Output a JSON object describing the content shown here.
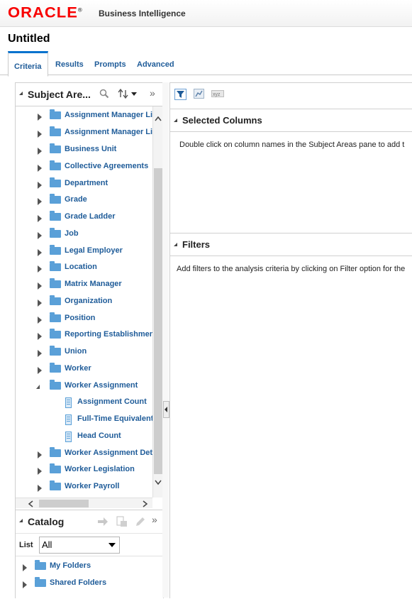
{
  "header": {
    "logo": "ORACLE",
    "trademark": "®",
    "product": "Business Intelligence"
  },
  "page": {
    "title": "Untitled"
  },
  "tabs": [
    {
      "label": "Criteria",
      "active": true
    },
    {
      "label": "Results",
      "active": false
    },
    {
      "label": "Prompts",
      "active": false
    },
    {
      "label": "Advanced",
      "active": false
    }
  ],
  "subject_areas": {
    "title": "Subject Are...",
    "items": [
      {
        "label": "Assignment Manager Lis",
        "type": "folder"
      },
      {
        "label": "Assignment Manager Lis",
        "type": "folder"
      },
      {
        "label": "Business Unit",
        "type": "folder"
      },
      {
        "label": "Collective Agreements",
        "type": "folder"
      },
      {
        "label": "Department",
        "type": "folder"
      },
      {
        "label": "Grade",
        "type": "folder"
      },
      {
        "label": "Grade Ladder",
        "type": "folder"
      },
      {
        "label": "Job",
        "type": "folder"
      },
      {
        "label": "Legal Employer",
        "type": "folder"
      },
      {
        "label": "Location",
        "type": "folder"
      },
      {
        "label": "Matrix Manager",
        "type": "folder"
      },
      {
        "label": "Organization",
        "type": "folder"
      },
      {
        "label": "Position",
        "type": "folder"
      },
      {
        "label": "Reporting Establishment",
        "type": "folder"
      },
      {
        "label": "Union",
        "type": "folder"
      },
      {
        "label": "Worker",
        "type": "folder"
      },
      {
        "label": "Worker Assignment",
        "type": "folder-open"
      },
      {
        "label": "Assignment Count",
        "type": "column"
      },
      {
        "label": "Full-Time Equivalent",
        "type": "column"
      },
      {
        "label": "Head Count",
        "type": "column"
      },
      {
        "label": "Worker Assignment Deta",
        "type": "folder"
      },
      {
        "label": "Worker Legislation",
        "type": "folder"
      },
      {
        "label": "Worker Payroll",
        "type": "folder"
      }
    ]
  },
  "catalog": {
    "title": "Catalog",
    "list_label": "List",
    "list_value": "All",
    "items": [
      {
        "label": "My Folders"
      },
      {
        "label": "Shared Folders"
      }
    ]
  },
  "selected_columns": {
    "title": "Selected Columns",
    "message": "Double click on column names in the Subject Areas pane to add t"
  },
  "filters": {
    "title": "Filters",
    "message": "Add filters to the analysis criteria by clicking on Filter option for the"
  }
}
